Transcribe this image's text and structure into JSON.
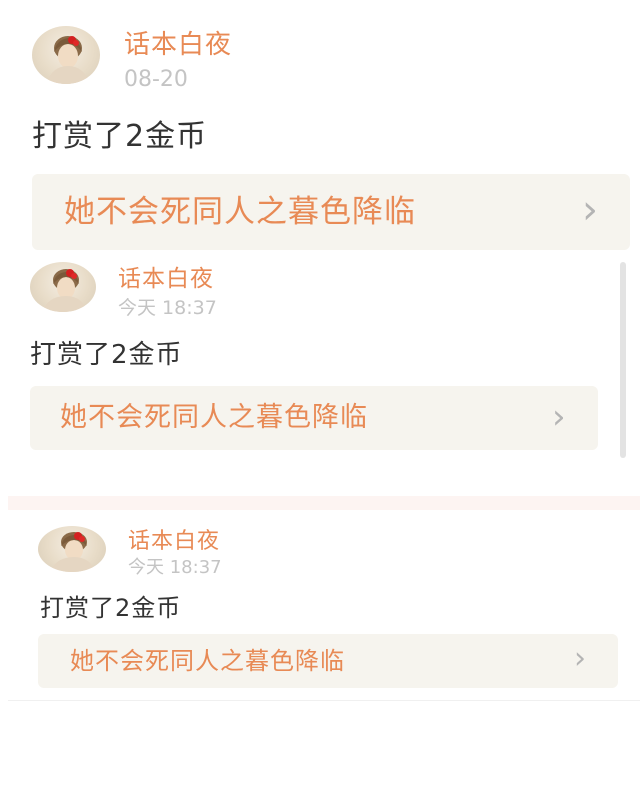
{
  "entries": [
    {
      "username": "话本白夜",
      "timestamp": "08-20",
      "message": "打赏了2金币",
      "book_title": "她不会死同人之暮色降临",
      "chevron": "›"
    },
    {
      "username": "话本白夜",
      "timestamp": "今天 18:37",
      "message": "打赏了2金币",
      "book_title": "她不会死同人之暮色降临",
      "chevron": "›"
    },
    {
      "username": "话本白夜",
      "timestamp": "今天 18:37",
      "message": "打赏了2金币",
      "book_title": "她不会死同人之暮色降临",
      "chevron": "›"
    }
  ],
  "colors": {
    "accent": "#e88a55",
    "timestamp": "#c4c4c4",
    "text": "#333333",
    "box_bg": "#f6f4ee",
    "chevron": "#b4b4b4"
  },
  "icons": {
    "avatar": "user-avatar-icon",
    "chevron": "chevron-right-icon"
  }
}
